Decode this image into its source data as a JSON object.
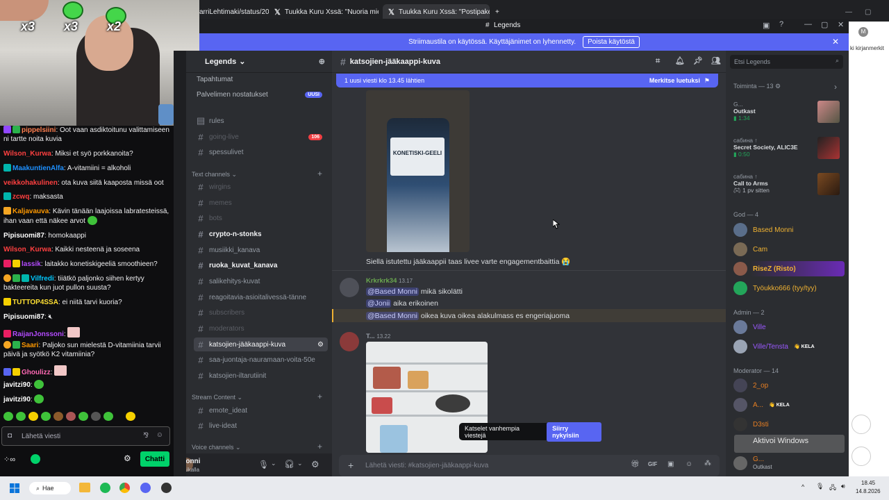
{
  "browser": {
    "tabs": [
      {
        "label": "arriLehtimaki/status/20",
        "active": false
      },
      {
        "label": "Tuukka Kuru Xssä: \"Nuoria mie",
        "active": false
      },
      {
        "label": "Tuukka Kuru Xssä: \"Postipakett",
        "active": true
      }
    ],
    "new_tab": "+"
  },
  "discord_title": "Legends",
  "banner": {
    "text": "Striimaustila on käytössä. Käyttäjänimet on lyhennetty.",
    "button": "Poista käytöstä"
  },
  "webcam_badges": [
    "x3",
    "x3",
    "x2"
  ],
  "chat": {
    "messages": [
      {
        "user": "pippelsiini",
        "color": "#ff7f50",
        "text": "Oot vaan asdiktoitunu valittamiseen ni tartte noita kuvia"
      },
      {
        "user": "Wilson_Kurwa",
        "color": "#ff4040",
        "text": "Miksi et syö porkkanoita?"
      },
      {
        "user": "MaakuntienAlfa",
        "color": "#1e90ff",
        "text": "A-vitamiini = alkoholi"
      },
      {
        "user": "veikkohakulinen",
        "color": "#ff4040",
        "text": "ota kuva siitä kaaposta missä oot"
      },
      {
        "user": "zcwq",
        "color": "#ff4040",
        "text": "maksasta"
      },
      {
        "user": "Kaljavauva",
        "color": "#ff9900",
        "text": "Kävin tänään laajoissa labratesteissä, ihan vaan että näkee arvot"
      },
      {
        "user": "Pipisuomi87",
        "color": "#ffffff",
        "text": "homokaappi"
      },
      {
        "user": "Wilson_Kurwa",
        "color": "#ff4040",
        "text": "Kaikki nesteenä ja soseena"
      },
      {
        "user": "lassik",
        "color": "#b44bff",
        "text": "laitakko konetiskigeeliä smoothieen?"
      },
      {
        "user": "Vilfredi",
        "color": "#00c8ff",
        "text": "tiiätkö paljonko siihen kertyy bakteereita kun juot pullon suusta?"
      },
      {
        "user": "TUTTOP4SSA",
        "color": "#ffe033",
        "text": "ei niitä tarvi kuoria?"
      },
      {
        "user": "Pipisuomi87",
        "color": "#ffffff",
        "text": ""
      },
      {
        "user": "RaijanJonssoni",
        "color": "#b44bff",
        "text": ""
      },
      {
        "user": "Saari",
        "color": "#ff9900",
        "text": "Paljoko sun mielestä D-vitamiinia tarvii päivä ja syötkö K2 vitamiinia?"
      },
      {
        "user": "Ghoulizz",
        "color": "#ff69b4",
        "text": ""
      },
      {
        "user": "javitzi90",
        "color": "#ffffff",
        "text": ""
      },
      {
        "user": "javitzi90",
        "color": "#ffffff",
        "text": ""
      }
    ],
    "input_placeholder": "Lähetä viesti",
    "chat_button": "Chatti"
  },
  "guild": {
    "name": "Legends",
    "top_items": [
      {
        "label": "Tapahtumat"
      },
      {
        "label": "Palvelimen nostatukset",
        "badge": "UUSI"
      }
    ],
    "channels_a": [
      {
        "label": "rules",
        "style": "normal"
      },
      {
        "label": "going-live",
        "style": "muted",
        "badge": "106"
      },
      {
        "label": "spessulivet",
        "style": "normal"
      }
    ],
    "category_text": "Text channels",
    "channels_b": [
      {
        "label": "wirgins",
        "style": "muted"
      },
      {
        "label": "memes",
        "style": "muted"
      },
      {
        "label": "bots",
        "style": "muted"
      },
      {
        "label": "crypto-n-stonks",
        "style": "bold"
      },
      {
        "label": "musiikki_kanava",
        "style": "normal"
      },
      {
        "label": "ruoka_kuvat_kanava",
        "style": "bold"
      },
      {
        "label": "salikehitys-kuvat",
        "style": "normal"
      },
      {
        "label": "reagoitavia-asioitalivessä-tänne",
        "style": "normal"
      },
      {
        "label": "subscribers",
        "style": "muted"
      },
      {
        "label": "moderators",
        "style": "muted"
      },
      {
        "label": "katsojien-jääkaappi-kuva",
        "style": "active"
      },
      {
        "label": "saa-juontaja-nauramaan-voita-50e",
        "style": "normal"
      },
      {
        "label": "katsojien-iltarutiinit",
        "style": "normal"
      }
    ],
    "category_stream": "Stream Content",
    "channels_c": [
      {
        "label": "emote_ideat",
        "style": "normal"
      },
      {
        "label": "live-ideat",
        "style": "normal"
      }
    ],
    "category_voice": "Voice channels",
    "user": {
      "name": "Monni",
      "status": "Paikalla"
    }
  },
  "main": {
    "channel": "katsojien-jääkaappi-kuva",
    "new_messages": "1 uusi viesti klo 13.45 lähtien",
    "mark_read": "Merkitse luetuksi",
    "bottle_label": "KONETISKI-GEELI",
    "msg1": "Siellä istutettu jääkaappii taas livee varte engagementbaittia",
    "msg2_author": "Krkrkrk34",
    "msg2_time": "13.17",
    "msg2_lines": [
      {
        "mention": "@Based Monni",
        "text": " mikä sikolätti"
      },
      {
        "mention": "@Jonii",
        "text": " aika erikoinen"
      },
      {
        "mention": "@Based Monni",
        "text": " oikea kuva oikea alakulmass es engeriajuoma"
      }
    ],
    "msg3_author": "T...",
    "msg3_time": "13.22",
    "jump_text": "Katselet vanhempia viestejä",
    "jump_button": "Siirry nykyisiin",
    "composer_placeholder": "Lähetä viesti: #katsojien-jääkaappi-kuva"
  },
  "members": {
    "search_placeholder": "Etsi Legends",
    "activity_header": "Toiminta — 13",
    "activities": [
      {
        "line1": "G...",
        "line2": "Outkast",
        "line3": "1:34"
      },
      {
        "line1": "сабина ↑",
        "line2": "Secret Society, ALIC3E",
        "line3": "0:50"
      },
      {
        "line1": "сабина ↑",
        "line2": "Call to Arms",
        "line3": "1 pv sitten"
      }
    ],
    "groups": [
      {
        "header": "God — 4",
        "members": [
          {
            "name": "Based Monni",
            "color": "#f0b232"
          },
          {
            "name": "Cam",
            "color": "#f0b232"
          },
          {
            "name": "RiseZ (Risto)",
            "color": "#f0b232"
          },
          {
            "name": "Työukko666 (tyy/tyy)",
            "color": "#f0b232"
          }
        ]
      },
      {
        "header": "Admin — 2",
        "members": [
          {
            "name": "Ville",
            "color": "#9b59ff"
          },
          {
            "name": "Ville/Tensta",
            "color": "#9b59ff",
            "tag": "KELA"
          }
        ]
      },
      {
        "header": "Moderator — 14",
        "members": [
          {
            "name": "2_op",
            "color": "#e67e22"
          },
          {
            "name": "A...",
            "color": "#e67e22",
            "tag": "KELA"
          },
          {
            "name": "D3sti",
            "color": "#e67e22"
          },
          {
            "name": "G...",
            "color": "#e67e22",
            "sub": "Outkast"
          }
        ]
      }
    ],
    "watermark": "Aktivoi Windows"
  },
  "right_page": {
    "text": "ki kirjanmerkit"
  },
  "taskbar": {
    "search": "Hae",
    "time": "18.45",
    "date": "14.8.2026"
  }
}
